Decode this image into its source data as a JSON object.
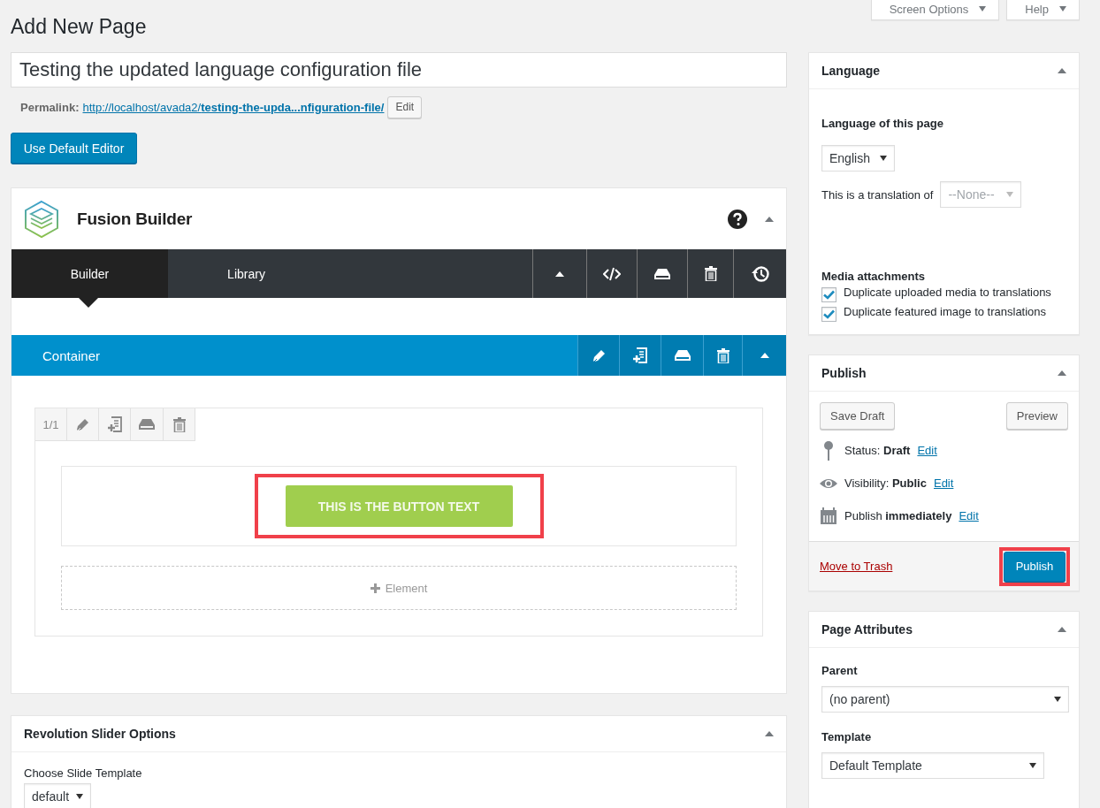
{
  "page_title": "Add New Page",
  "header_tabs": [
    {
      "label": "Screen Options"
    },
    {
      "label": "Help"
    }
  ],
  "title_field": {
    "value": "Testing the updated language configuration file"
  },
  "permalink": {
    "label": "Permalink:",
    "url": "http://localhost/avada2/**testing-the-upda...nfiguration-file/**",
    "edit": "Edit"
  },
  "default_editor_button": "Use Default Editor",
  "fusion_builder": {
    "title": "Fusion Builder",
    "tabs": [
      {
        "label": "Builder",
        "selected": true
      },
      {
        "label": "Library",
        "selected": false
      }
    ],
    "container": {
      "title": "Container",
      "column": {
        "size": "1/1",
        "elements": [
          {
            "kind": "button",
            "label": "THIS IS THE BUTTON TEXT",
            "highlighted": true
          }
        ],
        "add_element": "Element"
      }
    }
  },
  "revolution_slider": {
    "title": "Revolution Slider Options",
    "template_label": "Choose Slide Template",
    "template_value": "default"
  },
  "language_box": {
    "title": "Language",
    "language_label": "Language of this page",
    "language_value": "English",
    "translation_label": "This is a translation of",
    "translation_value": "--None--",
    "translation_disabled": true,
    "media_label": "Media attachments",
    "options": [
      {
        "label": "Duplicate uploaded media to translations",
        "checked": true
      },
      {
        "label": "Duplicate featured image to translations",
        "checked": true
      }
    ]
  },
  "publish_box": {
    "title": "Publish",
    "save_draft": "Save Draft",
    "preview": "Preview",
    "meta": [
      {
        "kind": "status",
        "text": "Status: **Draft**",
        "link": "Edit"
      },
      {
        "kind": "visibility",
        "text": "Visibility: **Public**",
        "link": "Edit"
      },
      {
        "kind": "schedule",
        "text": "Publish **immediately**",
        "link": "Edit"
      }
    ],
    "trash": "Move to Trash",
    "publish": {
      "label": "Publish",
      "highlighted": true
    }
  },
  "page_attributes": {
    "title": "Page Attributes",
    "parent_label": "Parent",
    "parent_value": "(no parent)",
    "template_label": "Template",
    "template_value": "Default Template"
  }
}
